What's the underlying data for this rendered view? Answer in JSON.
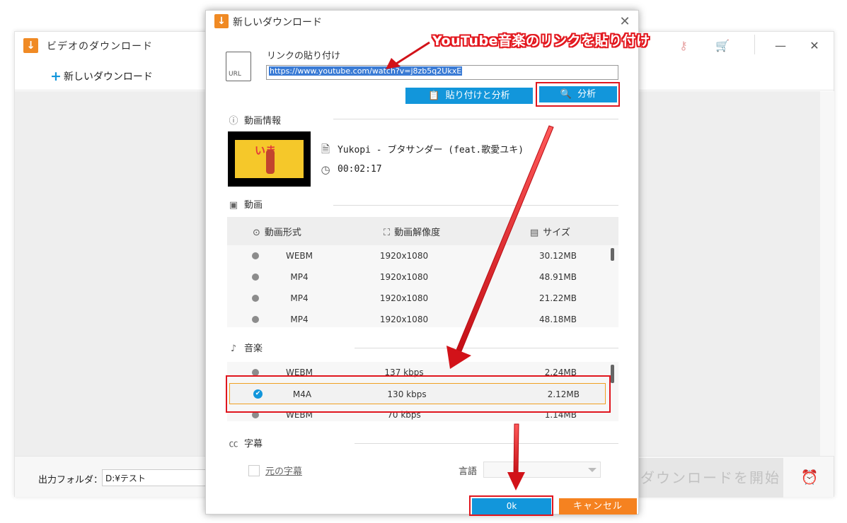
{
  "main_window": {
    "title": "ビデオのダウンロード",
    "new_download_label": "新しいダウンロード",
    "output_folder_label": "出力フォルダ：",
    "output_folder_value": "D:¥テスト",
    "start_button_label": "ダウンロードを開始",
    "icons": [
      "key-icon",
      "cart-icon",
      "minimize-icon",
      "close-icon",
      "alarm-clock-icon"
    ]
  },
  "dialog": {
    "title": "新しいダウンロード",
    "paste_link_label": "リンクの貼り付け",
    "url_value": "https://www.youtube.com/watch?v=j8zb5q2UkxE",
    "paste_analyze_button": "貼り付けと分析",
    "analyze_button": "分析",
    "video_info": {
      "section_label": "動画情報",
      "title": "Yukopi - ブタサンダー (feat.歌愛ユキ)",
      "duration": "00:02:17",
      "thumbnail_text": "いま"
    },
    "video": {
      "section_label": "動画",
      "columns": [
        "動画形式",
        "動画解像度",
        "サイズ"
      ],
      "rows": [
        {
          "format": "WEBM",
          "resolution": "1920x1080",
          "size": "30.12MB"
        },
        {
          "format": "MP4",
          "resolution": "1920x1080",
          "size": "48.91MB"
        },
        {
          "format": "MP4",
          "resolution": "1920x1080",
          "size": "21.22MB"
        },
        {
          "format": "MP4",
          "resolution": "1920x1080",
          "size": "48.18MB"
        }
      ]
    },
    "music": {
      "section_label": "音楽",
      "rows": [
        {
          "format": "WEBM",
          "bitrate": "137 kbps",
          "size": "2.24MB"
        },
        {
          "format": "M4A",
          "bitrate": "130 kbps",
          "size": "2.12MB"
        },
        {
          "format": "WEBM",
          "bitrate": "70 kbps",
          "size": "1.14MB"
        }
      ],
      "selected_index": 1
    },
    "subtitles": {
      "section_label": "字幕",
      "original_subtitle_label": "元の字幕",
      "language_label": "言語",
      "language_value": ""
    },
    "ok_button": "0k",
    "cancel_button": "キャンセル"
  },
  "annotation": {
    "callout_text": "YouTube音楽のリンクを貼り付け",
    "color": "#e0161e"
  },
  "colors": {
    "accent_blue": "#1296db",
    "orange": "#f58220",
    "selection_border": "#f0a022"
  }
}
